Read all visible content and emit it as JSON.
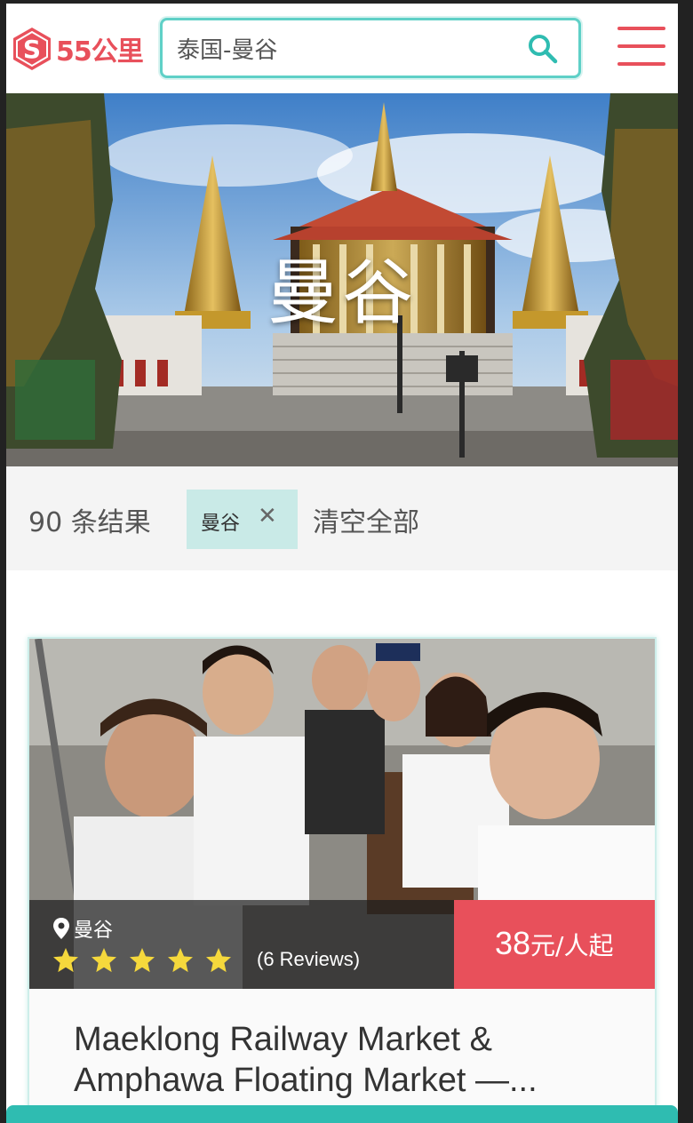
{
  "header": {
    "logo_text": "55公里",
    "search_value": "泰国-曼谷",
    "colors": {
      "brand": "#e8505b",
      "accent": "#5fd0c7"
    }
  },
  "hero": {
    "title": "曼谷"
  },
  "filters": {
    "result_count": "90 条结果",
    "chips": [
      {
        "label": "曼谷",
        "close": "✕"
      }
    ],
    "clear_all": "清空全部"
  },
  "cards": [
    {
      "location": "曼谷",
      "rating": 5,
      "reviews": "(6 Reviews)",
      "price_value": "38",
      "price_unit": "元/人起",
      "title": "Maeklong Railway Market & Amphawa Floating Market —..."
    }
  ]
}
